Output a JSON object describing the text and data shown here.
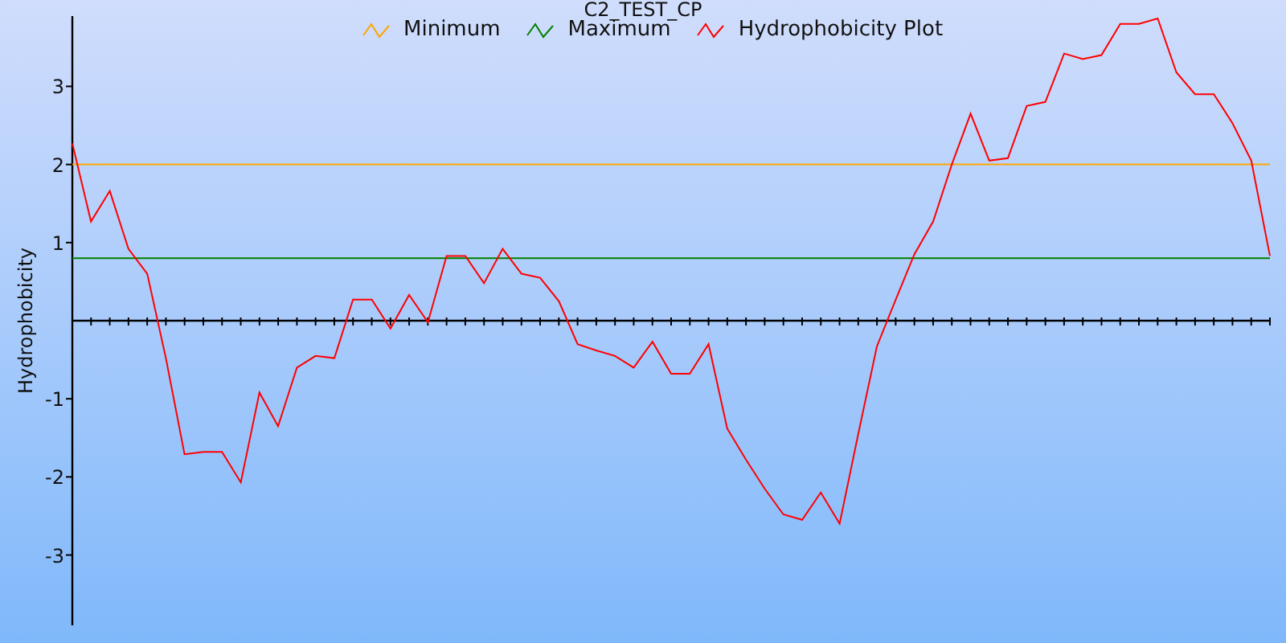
{
  "plot": {
    "chart_data": {
      "type": "line",
      "title": "C2_TEST_CP",
      "ylabel": "Hydrophobicity",
      "categories": [
        null,
        null,
        null,
        null,
        null,
        null,
        null,
        null,
        null,
        null,
        null,
        null,
        null,
        null,
        null,
        null,
        null,
        null,
        null,
        null,
        null,
        null,
        null,
        null,
        null,
        null,
        null,
        null,
        null,
        null,
        null,
        null,
        null,
        null,
        null,
        null,
        null,
        null,
        null,
        null,
        null,
        null,
        null,
        null,
        null,
        null,
        null,
        null,
        null,
        null,
        null,
        null,
        null,
        null,
        null,
        null,
        null,
        null,
        null,
        null,
        null,
        null,
        null,
        null,
        null
      ],
      "ylim": [
        -3.9,
        3.9
      ],
      "yticks": [
        -3,
        -2,
        -1,
        1,
        2,
        3
      ],
      "series": [
        {
          "name": "Minimum",
          "color": "#ffa500",
          "values": [
            2,
            2,
            2,
            2,
            2,
            2,
            2,
            2,
            2,
            2,
            2,
            2,
            2,
            2,
            2,
            2,
            2,
            2,
            2,
            2,
            2,
            2,
            2,
            2,
            2,
            2,
            2,
            2,
            2,
            2,
            2,
            2,
            2,
            2,
            2,
            2,
            2,
            2,
            2,
            2,
            2,
            2,
            2,
            2,
            2,
            2,
            2,
            2,
            2,
            2,
            2,
            2,
            2,
            2,
            2,
            2,
            2,
            2,
            2,
            2,
            2,
            2,
            2,
            2,
            2
          ]
        },
        {
          "name": "Maximum",
          "color": "#008000",
          "values": [
            0.8,
            0.8,
            0.8,
            0.8,
            0.8,
            0.8,
            0.8,
            0.8,
            0.8,
            0.8,
            0.8,
            0.8,
            0.8,
            0.8,
            0.8,
            0.8,
            0.8,
            0.8,
            0.8,
            0.8,
            0.8,
            0.8,
            0.8,
            0.8,
            0.8,
            0.8,
            0.8,
            0.8,
            0.8,
            0.8,
            0.8,
            0.8,
            0.8,
            0.8,
            0.8,
            0.8,
            0.8,
            0.8,
            0.8,
            0.8,
            0.8,
            0.8,
            0.8,
            0.8,
            0.8,
            0.8,
            0.8,
            0.8,
            0.8,
            0.8,
            0.8,
            0.8,
            0.8,
            0.8,
            0.8,
            0.8,
            0.8,
            0.8,
            0.8,
            0.8,
            0.8,
            0.8,
            0.8,
            0.8,
            0.8
          ]
        },
        {
          "name": "Hydrophobicity Plot",
          "color": "#ff0000",
          "values": [
            2.27,
            1.27,
            1.66,
            0.92,
            0.6,
            -0.48,
            -1.71,
            -1.68,
            -1.68,
            -2.07,
            -0.92,
            -1.35,
            -0.6,
            -0.45,
            -0.48,
            0.27,
            0.27,
            -0.1,
            0.33,
            -0.02,
            0.83,
            0.83,
            0.48,
            0.92,
            0.6,
            0.55,
            0.25,
            -0.3,
            -0.38,
            -0.45,
            -0.6,
            -0.27,
            -0.68,
            -0.68,
            -0.3,
            -1.38,
            -1.78,
            -2.15,
            -2.48,
            -2.55,
            -2.2,
            -2.6,
            -1.45,
            -0.33,
            0.27,
            0.85,
            1.27,
            2.0,
            2.65,
            2.05,
            2.08,
            2.75,
            2.8,
            3.42,
            3.35,
            3.4,
            3.8,
            3.8,
            3.87,
            3.18,
            2.9,
            2.9,
            2.53,
            2.05,
            0.83
          ]
        }
      ]
    }
  }
}
